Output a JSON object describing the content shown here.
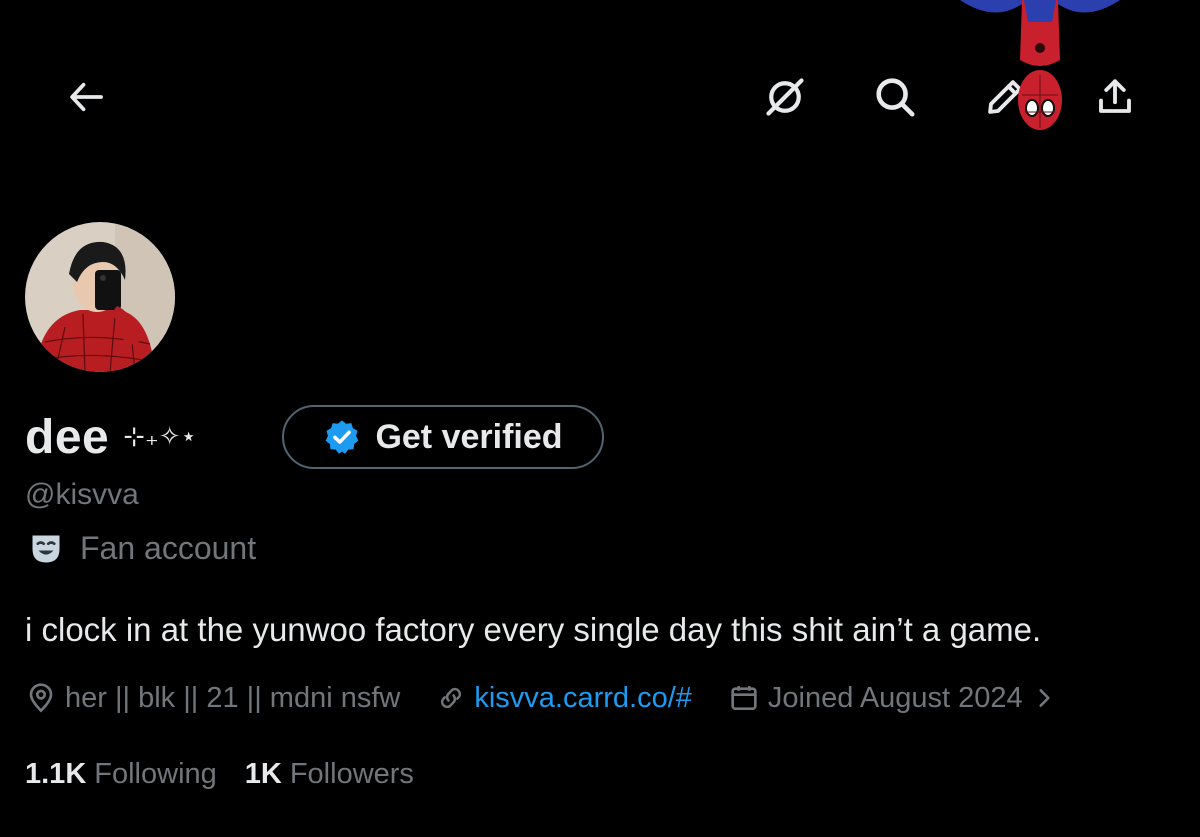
{
  "header": {
    "icons": [
      "back-arrow-icon",
      "grok-icon",
      "search-icon",
      "edit-pencil-icon",
      "share-icon"
    ]
  },
  "profile": {
    "display_name": "dee",
    "name_sparkles": "⊹₊✧⋆",
    "verify_button_label": "Get verified",
    "handle": "@kisvva",
    "category_icon": "theater-mask-icon",
    "category_label": "Fan account",
    "bio": "i clock in at the yunwoo factory every single day this shit ain’t a game.",
    "location": "her || blk || 21 || mdni nsfw",
    "website": "kisvva.carrd.co/#",
    "joined": "Joined August 2024",
    "following_count": "1.1K",
    "following_label": "Following",
    "followers_count": "1K",
    "followers_label": "Followers"
  },
  "colors": {
    "background": "#000000",
    "primary_text": "#e7e9ea",
    "secondary_text": "#71767b",
    "link": "#1d9bf0",
    "verified_badge": "#1d9bf0",
    "button_border": "#536471"
  }
}
